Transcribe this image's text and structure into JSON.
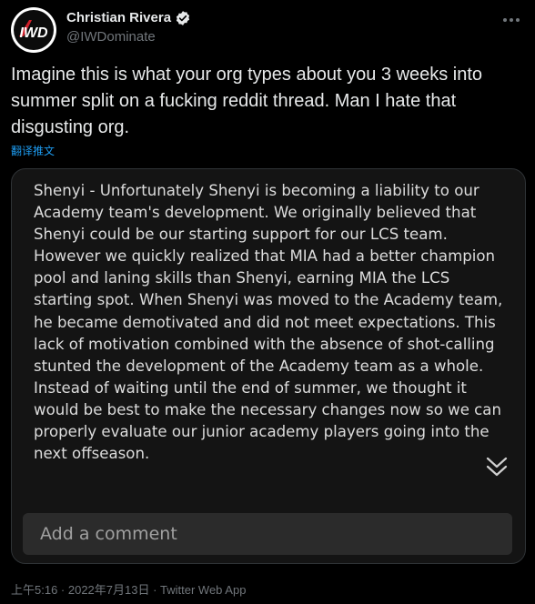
{
  "author": {
    "name": "Christian Rivera",
    "handle": "@IWDominate",
    "avatar_text": "IWD",
    "verified_icon": "verified-badge-icon"
  },
  "tweet": {
    "text": "Imagine this is what your org types about you 3 weeks into summer split on a fucking reddit thread.  Man I hate that disgusting org.",
    "translate_label": "翻译推文"
  },
  "media_card": {
    "body": "Shenyi - Unfortunately Shenyi is becoming a liability to our Academy team's development. We originally believed that Shenyi could be our starting support for our LCS team. However we quickly realized that MIA had a better champion pool and laning skills than Shenyi, earning MIA the LCS starting spot. When Shenyi was moved to the Academy team, he became demotivated and did not meet expectations. This lack of motivation combined with the absence of shot-calling stunted the development of the Academy team as a whole. Instead of waiting until the end of summer, we thought it would be best to make the necessary changes now so we can properly evaluate our junior academy players going into the next offseason.",
    "comment_placeholder": "Add a comment"
  },
  "footer": {
    "meta": "上午5:16 · 2022年7月13日 · Twitter Web App"
  },
  "colors": {
    "background": "#000000",
    "text": "#e7e9ea",
    "secondary": "#71767b",
    "link": "#1d9bf0",
    "card": "#141414"
  }
}
